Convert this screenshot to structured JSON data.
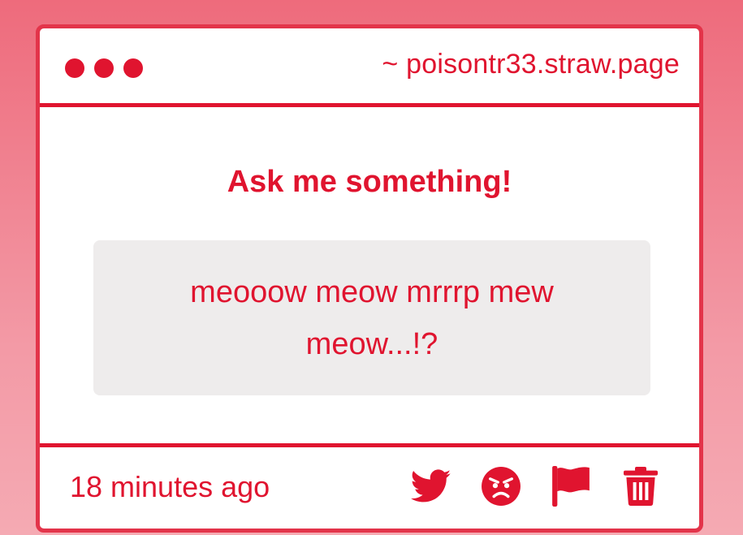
{
  "colors": {
    "accent": "#e0142f",
    "border": "#e3344a",
    "question_bg": "#eeecec",
    "background_top": "#ee6b7c",
    "background_bottom": "#f5aab3"
  },
  "window": {
    "url": "~ poisontr33.straw.page"
  },
  "main": {
    "heading": "Ask me something!",
    "question": "meooow meow mrrrp mew meow...!?"
  },
  "footer": {
    "timestamp": "18 minutes ago",
    "actions": [
      {
        "icon": "twitter-icon"
      },
      {
        "icon": "angry-face-icon"
      },
      {
        "icon": "flag-icon"
      },
      {
        "icon": "trash-icon"
      }
    ]
  }
}
